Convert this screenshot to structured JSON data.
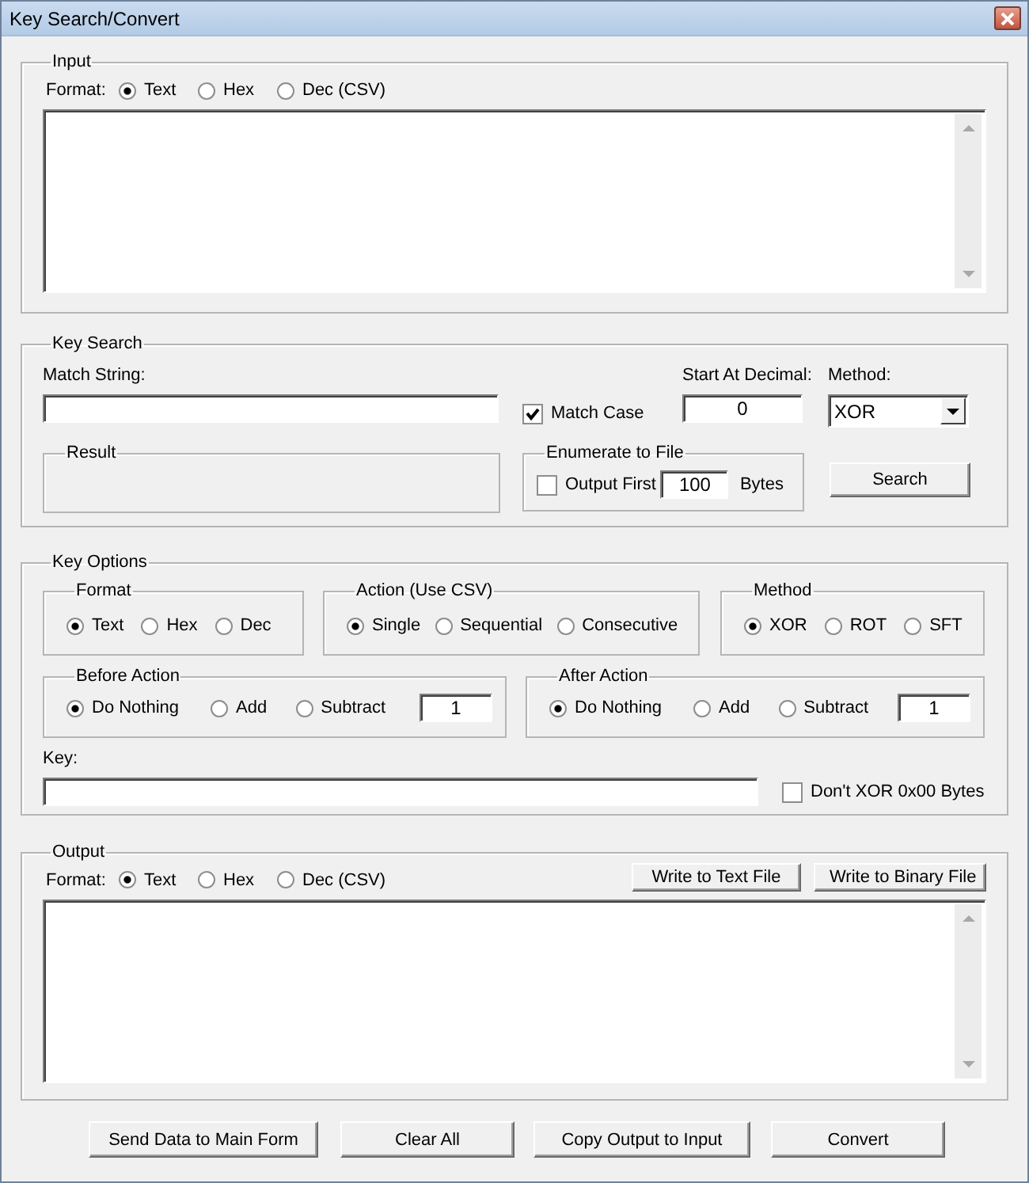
{
  "window": {
    "title": "Key Search/Convert"
  },
  "input": {
    "label": "Input",
    "format_label": "Format:",
    "formats": [
      {
        "label": "Text",
        "selected": true
      },
      {
        "label": "Hex",
        "selected": false
      },
      {
        "label": "Dec (CSV)",
        "selected": false
      }
    ]
  },
  "key_search": {
    "label": "Key Search",
    "match_string_label": "Match String:",
    "match_case": {
      "label": "Match Case",
      "checked": true
    },
    "start_at": {
      "label": "Start At Decimal:",
      "value": "0"
    },
    "method": {
      "label": "Method:",
      "value": "XOR"
    },
    "result": {
      "label": "Result"
    },
    "enumerate": {
      "label": "Enumerate to File",
      "output_first": {
        "label": "Output First",
        "checked": false
      },
      "count": "100",
      "unit": "Bytes"
    },
    "search_button": "Search"
  },
  "key_options": {
    "label": "Key Options",
    "groups": [
      {
        "label": "Format",
        "options": [
          {
            "label": "Text",
            "selected": true
          },
          {
            "label": "Hex",
            "selected": false
          },
          {
            "label": "Dec",
            "selected": false
          }
        ]
      },
      {
        "label": "Action (Use CSV)",
        "options": [
          {
            "label": "Single",
            "selected": true
          },
          {
            "label": "Sequential",
            "selected": false
          },
          {
            "label": "Consecutive",
            "selected": false
          }
        ]
      },
      {
        "label": "Method",
        "options": [
          {
            "label": "XOR",
            "selected": true
          },
          {
            "label": "ROT",
            "selected": false
          },
          {
            "label": "SFT",
            "selected": false
          }
        ]
      }
    ],
    "actions": [
      {
        "label": "Before Action",
        "options": [
          {
            "label": "Do Nothing",
            "selected": true
          },
          {
            "label": "Add",
            "selected": false
          },
          {
            "label": "Subtract",
            "selected": false
          }
        ],
        "value": "1"
      },
      {
        "label": "After Action",
        "options": [
          {
            "label": "Do Nothing",
            "selected": true
          },
          {
            "label": "Add",
            "selected": false
          },
          {
            "label": "Subtract",
            "selected": false
          }
        ],
        "value": "1"
      }
    ],
    "key_label": "Key:",
    "dont_xor": {
      "label": "Don't XOR 0x00 Bytes",
      "checked": false
    }
  },
  "output": {
    "label": "Output",
    "format_label": "Format:",
    "formats": [
      {
        "label": "Text",
        "selected": true
      },
      {
        "label": "Hex",
        "selected": false
      },
      {
        "label": "Dec (CSV)",
        "selected": false
      }
    ],
    "buttons": [
      "Write to Text File",
      "Write to Binary File"
    ]
  },
  "buttons": [
    "Send Data to Main Form",
    "Clear All",
    "Copy Output to Input",
    "Convert"
  ]
}
